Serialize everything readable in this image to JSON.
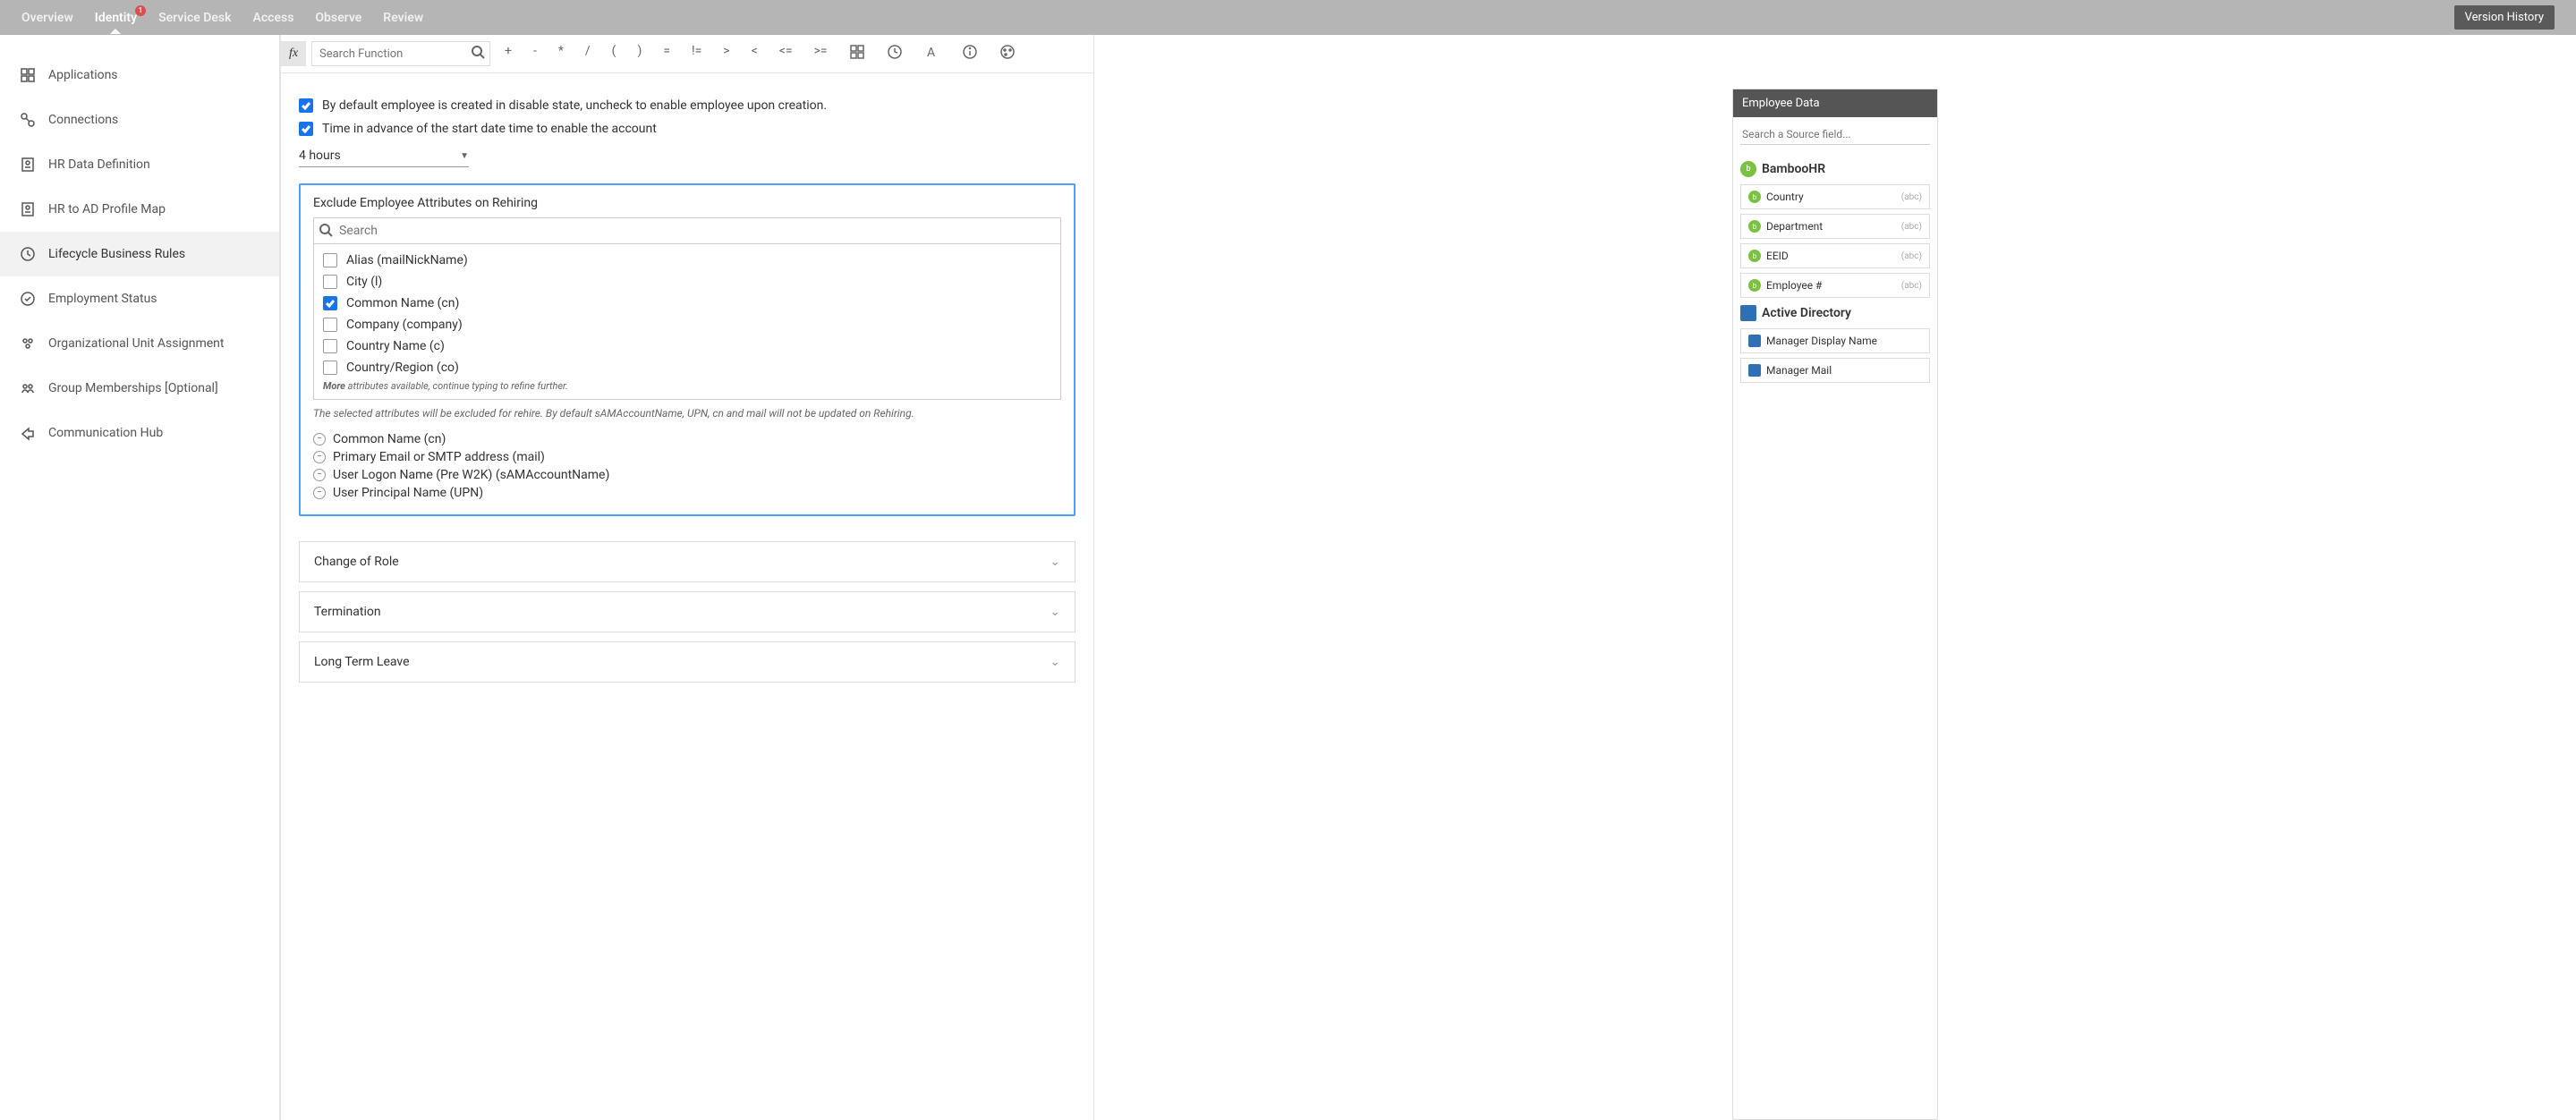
{
  "topnav": {
    "items": [
      "Overview",
      "Identity",
      "Service Desk",
      "Access",
      "Observe",
      "Review"
    ],
    "active": 1,
    "badge": "1",
    "history_btn": "Version History"
  },
  "sidebar": {
    "items": [
      {
        "label": "Applications"
      },
      {
        "label": "Connections"
      },
      {
        "label": "HR Data Definition"
      },
      {
        "label": "HR to AD Profile Map"
      },
      {
        "label": "Lifecycle Business Rules"
      },
      {
        "label": "Employment Status"
      },
      {
        "label": "Organizational Unit Assignment"
      },
      {
        "label": "Group Memberships [Optional]"
      },
      {
        "label": "Communication Hub"
      }
    ],
    "active": 4
  },
  "toolbar": {
    "search_placeholder": "Search Function",
    "ops": [
      "+",
      "-",
      "*",
      "/",
      "(",
      ")",
      "=",
      "!=",
      ">",
      "<",
      "<=",
      ">="
    ]
  },
  "checks": {
    "c1": "By default employee is created in disable state, uncheck to enable employee upon creation.",
    "c2": "Time in advance of the start date time to enable the account"
  },
  "time_select": "4 hours",
  "panel": {
    "title": "Exclude Employee Attributes on Rehiring",
    "search_placeholder": "Search",
    "attrs": [
      {
        "label": "Alias (mailNickName)",
        "checked": false
      },
      {
        "label": "City (l)",
        "checked": false
      },
      {
        "label": "Common Name (cn)",
        "checked": true
      },
      {
        "label": "Company (company)",
        "checked": false
      },
      {
        "label": "Country Name (c)",
        "checked": false
      },
      {
        "label": "Country/Region (co)",
        "checked": false
      }
    ],
    "more_prefix": "More",
    "more_rest": " attributes available, continue typing to refine further.",
    "help": "The selected attributes will be excluded for rehire. By default sAMAccountName, UPN, cn and mail will not be updated on Rehiring.",
    "excluded": [
      "Common Name (cn)",
      "Primary Email or SMTP address (mail)",
      "User Logon Name (Pre W2K) (sAMAccountName)",
      "User Principal Name (UPN)"
    ]
  },
  "accordions": [
    "Change of Role",
    "Termination",
    "Long Term Leave"
  ],
  "rightpanel": {
    "title": "Employee Data",
    "search_placeholder": "Search a Source field...",
    "sources": [
      {
        "name": "BambooHR",
        "logo": "bamboo",
        "glyph": "b",
        "fields": [
          {
            "label": "Country",
            "type": "(abc)"
          },
          {
            "label": "Department",
            "type": "(abc)"
          },
          {
            "label": "EEID",
            "type": "(abc)"
          },
          {
            "label": "Employee #",
            "type": "(abc)"
          }
        ]
      },
      {
        "name": "Active Directory",
        "logo": "ad",
        "glyph": "",
        "fields": [
          {
            "label": "Manager Display Name",
            "type": ""
          },
          {
            "label": "Manager Mail",
            "type": ""
          }
        ]
      }
    ]
  }
}
